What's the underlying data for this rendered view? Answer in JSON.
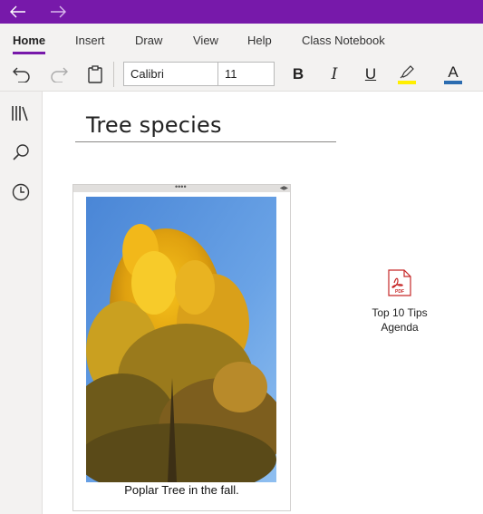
{
  "window": {
    "title_bar_color": "#7719aa"
  },
  "tabs": [
    {
      "label": "Home",
      "active": true
    },
    {
      "label": "Insert",
      "active": false
    },
    {
      "label": "Draw",
      "active": false
    },
    {
      "label": "View",
      "active": false
    },
    {
      "label": "Help",
      "active": false
    },
    {
      "label": "Class Notebook",
      "active": false
    }
  ],
  "toolbar": {
    "font_name": "Calibri",
    "font_size": "11",
    "bold_label": "B",
    "italic_label": "I",
    "underline_label": "U",
    "font_color_label": "A",
    "highlight_color": "#ffef00",
    "font_color": "#2b6cb0"
  },
  "page": {
    "title": "Tree species",
    "image_caption": "Poplar Tree in the fall.",
    "attachment_label": "Top 10 Tips Agenda",
    "attachment_badge": "PDF"
  }
}
